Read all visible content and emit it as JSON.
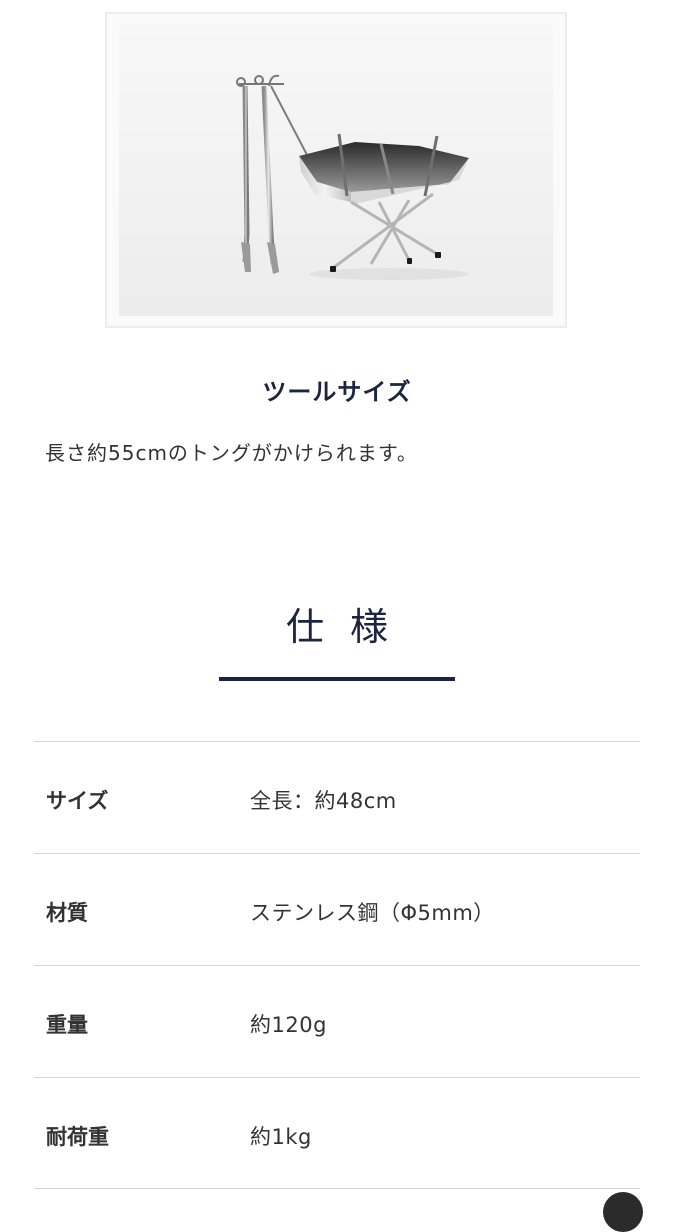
{
  "product_image": {
    "alt": "stainless tongs and folding grill stand product photo"
  },
  "section": {
    "heading": "ツールサイズ",
    "description": "長さ約55cmのトングがかけられます。"
  },
  "specs": {
    "title": "仕様",
    "rows": [
      {
        "label": "サイズ",
        "value": "全長：約48cm"
      },
      {
        "label": "材質",
        "value": "ステンレス鋼（Φ5mm）"
      },
      {
        "label": "重量",
        "value": "約120g"
      },
      {
        "label": "耐荷重",
        "value": "約1kg"
      }
    ]
  },
  "colors": {
    "accent": "#1b2540",
    "text": "#333333",
    "divider": "#d6d6d6"
  }
}
